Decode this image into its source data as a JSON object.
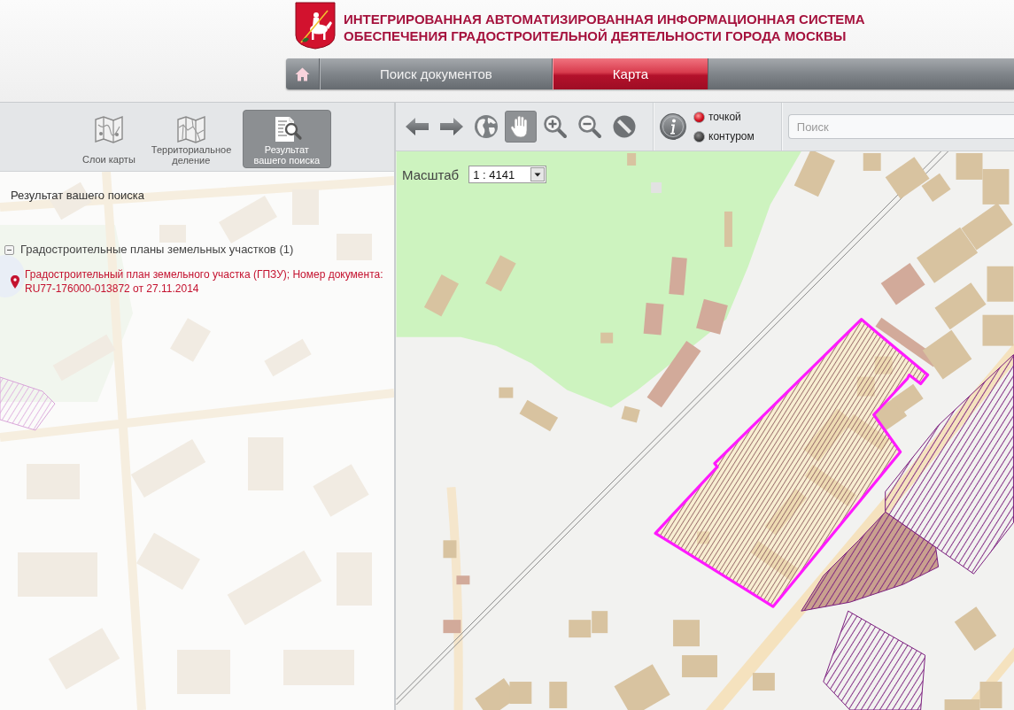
{
  "header": {
    "title_lines": [
      "ИНТЕГРИРОВАННАЯ АВТОМАТИЗИРОВАННАЯ ИНФОРМАЦИОННАЯ СИСТЕМА",
      "ОБЕСПЕЧЕНИЯ ГРАДОСТРОИТЕЛЬНОЙ ДЕЯТЕЛЬНОСТИ ГОРОДА МОСКВЫ"
    ]
  },
  "nav": {
    "tabs": [
      {
        "label": "Поиск документов",
        "selected": false
      },
      {
        "label": "Карта",
        "selected": true
      }
    ]
  },
  "panel": {
    "tabs": [
      {
        "label": "Слои карты",
        "selected": false
      },
      {
        "label": "Территориальное деление",
        "selected": false
      },
      {
        "label": "Результат вашего поиска",
        "selected": true
      }
    ],
    "heading": "Результат вашего поиска",
    "tree": [
      {
        "label": "Градостроительные планы земельных участков (1)",
        "expanded": true,
        "children": [
          {
            "label": "Градостроительный план земельного участка (ГПЗУ); Номер документа: RU77-176000-013872 от 27.11.2014"
          }
        ]
      }
    ]
  },
  "toolbar": {
    "tools": [
      {
        "selected": false
      },
      {
        "selected": false
      },
      {
        "selected": false
      },
      {
        "selected": true
      },
      {
        "selected": false
      },
      {
        "selected": false
      },
      {
        "selected": false
      }
    ],
    "select_modes": [
      {
        "label": "точкой",
        "selected": true
      },
      {
        "label": "контуром",
        "selected": false
      }
    ],
    "search": {
      "placeholder": "Поиск"
    }
  },
  "map": {
    "scale": {
      "label": "Масштаб",
      "value": "1 : 4141"
    }
  }
}
